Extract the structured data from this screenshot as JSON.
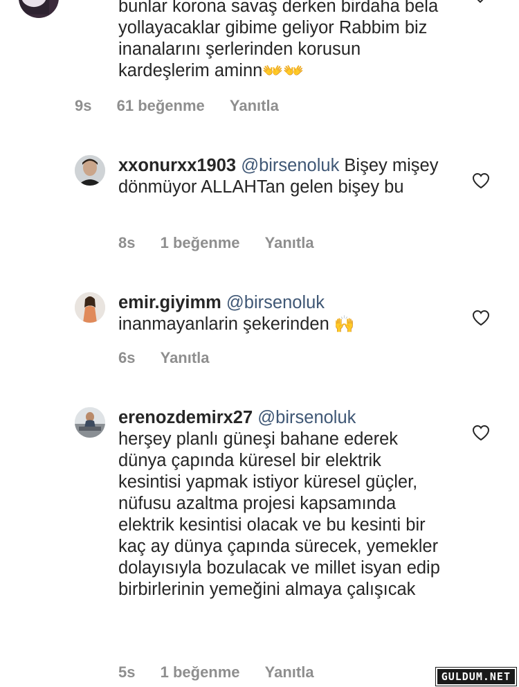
{
  "first_comment": {
    "text_lines": [
      "bunlar korona savaş derken birdaha bela",
      "yollayacaklar gibime geliyor Rabbim biz",
      "inanalarını şerlerinden korusun",
      "kardeşlerim aminn"
    ],
    "emoji": "👐👐",
    "time": "9s",
    "likes": "61 beğenme",
    "reply": "Yanıtla"
  },
  "comments": [
    {
      "username": "xxonurxx1903",
      "mention": "@birsenoluk",
      "text": "Bişey mişey dönmüyor ALLAHTan gelen bişey bu",
      "time": "8s",
      "likes": "1 beğenme",
      "reply": "Yanıtla"
    },
    {
      "username": "emir.giyimm",
      "mention": "@birsenoluk",
      "text": "inanmayanlarin şekerinden",
      "emoji": "🙌",
      "time": "6s",
      "reply": "Yanıtla"
    },
    {
      "username": "erenozdemirx27",
      "mention": "@birsenoluk",
      "text": "herşey planlı güneşi bahane ederek dünya çapında küresel bir elektrik kesintisi yapmak istiyor küresel güçler, nüfusu azaltma projesi kapsamında elektrik kesintisi olacak ve bu kesinti bir kaç ay dünya çapında sürecek, yemekler dolayısıyla bozulacak ve millet isyan edip birbirlerinin yemeğini almaya çalışıcak",
      "time": "5s",
      "likes": "1 beğenme",
      "reply": "Yanıtla"
    }
  ],
  "watermark": "GULDUM.NET",
  "icons": {
    "heart": "heart-outline-icon",
    "chevron": "chevron-down-icon"
  },
  "colors": {
    "text": "#262626",
    "meta": "#8e8e8e",
    "mention": "#3f5775"
  }
}
